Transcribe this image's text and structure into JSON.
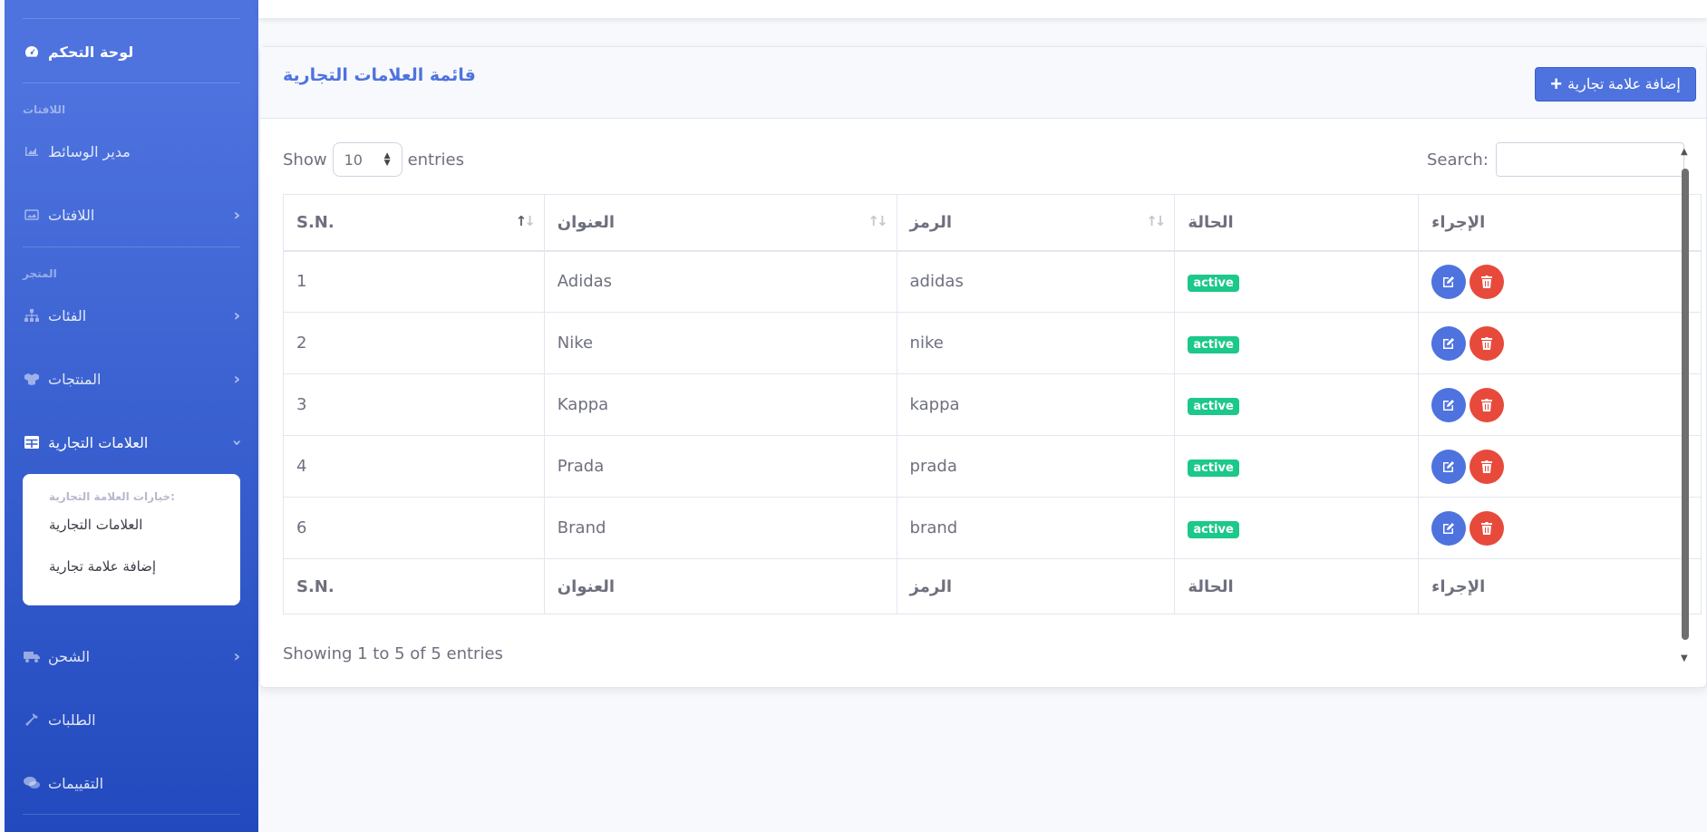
{
  "sidebar": {
    "dashboard": "لوحة التحكم",
    "heading_banners": "اللافتات",
    "media_manager": "مدير الوسائط",
    "banners": "اللافتات",
    "heading_store": "المتجر",
    "categories": "الفئات",
    "products": "المنتجات",
    "brands": "العلامات التجارية",
    "brand_options": {
      "header": "خيارات العلامة التجارية:",
      "links": [
        "العلامات التجارية",
        "إضافة علامة تجارية"
      ]
    },
    "shipping": "الشحن",
    "orders": "الطلبات",
    "reviews": "التقييمات"
  },
  "card": {
    "title": "قائمة العلامات التجارية",
    "add_button": "إضافة علامة تجارية"
  },
  "table_controls": {
    "show_label": "Show",
    "entries_label": "entries",
    "page_length": "10",
    "search_label": "Search:",
    "search_value": ""
  },
  "table": {
    "columns": [
      "S.N.",
      "العنوان",
      "الرمز",
      "الحالة",
      "الإجراء"
    ],
    "rows": [
      {
        "sn": "1",
        "title": "Adidas",
        "slug": "adidas",
        "status": "active"
      },
      {
        "sn": "2",
        "title": "Nike",
        "slug": "nike",
        "status": "active"
      },
      {
        "sn": "3",
        "title": "Kappa",
        "slug": "kappa",
        "status": "active"
      },
      {
        "sn": "4",
        "title": "Prada",
        "slug": "prada",
        "status": "active"
      },
      {
        "sn": "6",
        "title": "Brand",
        "slug": "brand",
        "status": "active"
      }
    ],
    "info": "Showing 1 to 5 of 5 entries"
  },
  "colors": {
    "primary": "#4e73df",
    "success": "#1cc88a",
    "danger": "#e74a3b"
  },
  "icons": {
    "dashboard": "tachometer-icon",
    "media": "chart-area-icon",
    "banners": "image-icon",
    "categories": "sitemap-icon",
    "products": "cubes-icon",
    "brands": "table-icon",
    "shipping": "truck-icon",
    "orders": "hammer-icon",
    "reviews": "comments-icon",
    "add": "plus-icon",
    "edit": "edit-icon",
    "delete": "trash-icon"
  }
}
